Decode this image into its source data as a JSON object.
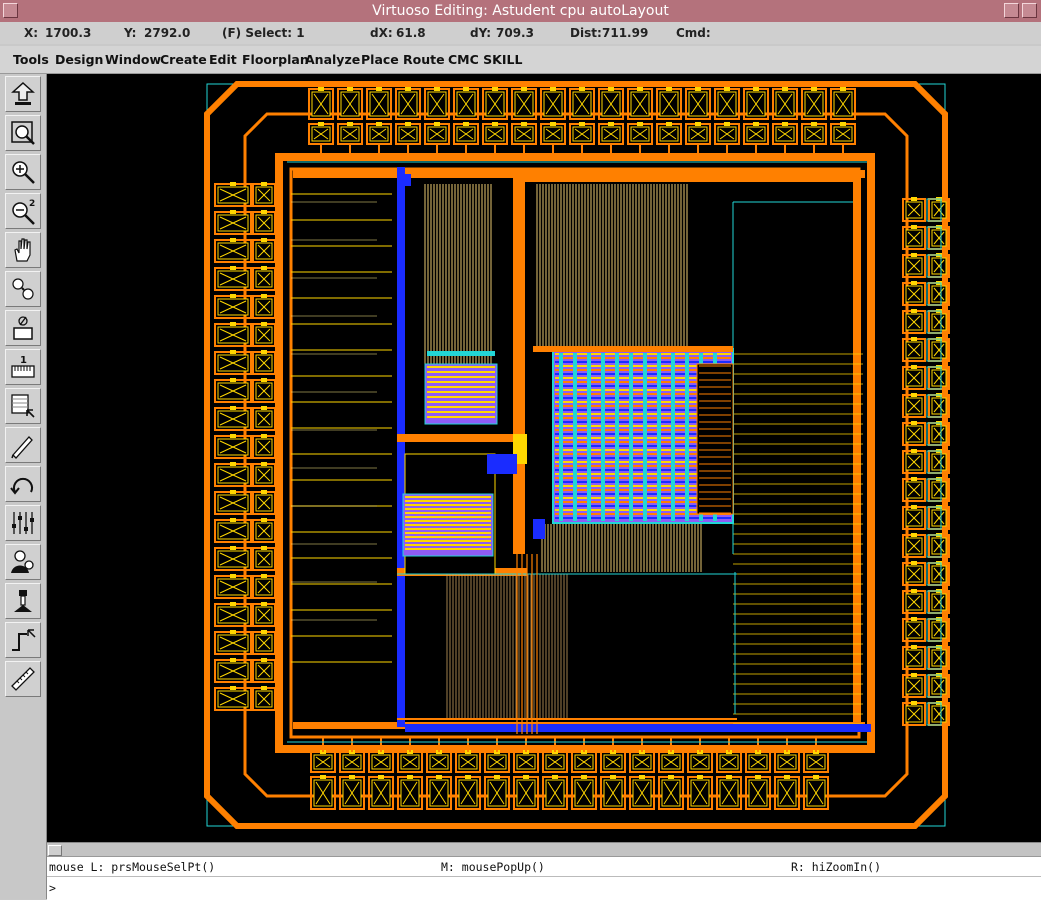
{
  "window": {
    "title": "Virtuoso Editing: Astudent cpu autoLayout"
  },
  "status": {
    "x_label": "X:",
    "x_value": "1700.3",
    "y_label": "Y:",
    "y_value": "2792.0",
    "select": "(F) Select: 1",
    "dx_label": "dX:",
    "dx_value": "61.8",
    "dy_label": "dY:",
    "dy_value": "709.3",
    "dist_label": "Dist:",
    "dist_value": "711.99",
    "cmd_label": "Cmd:",
    "cmd_value": ""
  },
  "menu": [
    "Tools",
    "Design",
    "Window",
    "Create",
    "Edit",
    "Floorplan",
    "Analyze",
    "Place",
    "Route",
    "CMC SKILL"
  ],
  "toolbar_icons": [
    "save-icon",
    "zoom-fit-icon",
    "zoom-in-icon",
    "zoom-out-2-icon",
    "pan-hand-icon",
    "zoom-box-icon",
    "stretch-icon",
    "ruler-grid-icon",
    "select-area-icon",
    "wire-pen-icon",
    "undo-arc-icon",
    "sliders-icon",
    "mouse-people-icon",
    "probe-icon",
    "path-step-icon",
    "ruler-icon"
  ],
  "zoom_in_label": "2",
  "ruler_grid_label": "1",
  "colors": {
    "background": "#000000",
    "orange": "#ff8000",
    "yellow": "#ffd700",
    "blue": "#1a2cff",
    "cyan": "#22d6d6",
    "purple": "#8e5cf5",
    "title_bar": "#b4727c"
  },
  "mouse": {
    "left": "mouse L: prsMouseSelPt()",
    "middle": "M: mousePopUp()",
    "right": "R: hiZoomIn()"
  },
  "prompt": ">"
}
